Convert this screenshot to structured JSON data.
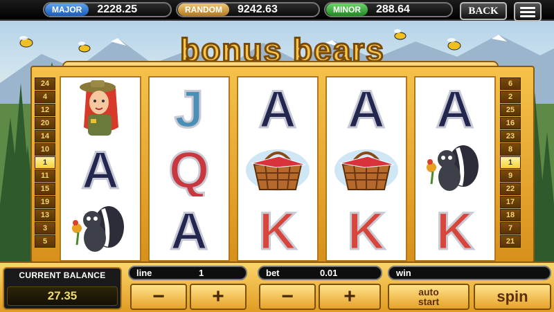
{
  "jackpots": {
    "major": {
      "label": "MAJOR",
      "value": "2228.25"
    },
    "random": {
      "label": "RANDOM",
      "value": "9242.63"
    },
    "minor": {
      "label": "MINOR",
      "value": "288.64"
    }
  },
  "nav": {
    "back_label": "BACK",
    "menu_icon": "hamburger-menu-icon"
  },
  "title": "bonus bears",
  "paylines": {
    "left": [
      "24",
      "4",
      "12",
      "20",
      "14",
      "10",
      "1",
      "11",
      "15",
      "19",
      "13",
      "3",
      "5"
    ],
    "right": [
      "6",
      "2",
      "25",
      "16",
      "23",
      "8",
      "1",
      "9",
      "22",
      "17",
      "18",
      "7",
      "21"
    ],
    "active": "1"
  },
  "reels": [
    [
      "ranger-girl",
      "A",
      "skunk"
    ],
    [
      "J",
      "Q",
      "A"
    ],
    [
      "A",
      "picnic-basket",
      "K"
    ],
    [
      "A",
      "picnic-basket",
      "K"
    ],
    [
      "A",
      "skunk",
      "K"
    ]
  ],
  "colors": {
    "frame": "#e8a52a",
    "A": "#23274f",
    "J": "#4c8fb5",
    "Q": "#c8383f",
    "K": "#d8453a"
  },
  "balance": {
    "label": "CURRENT BALANCE",
    "value": "27.35"
  },
  "line": {
    "label": "line",
    "value": "1"
  },
  "bet": {
    "label": "bet",
    "value": "0.01"
  },
  "win": {
    "label": "win",
    "value": ""
  },
  "controls": {
    "minus": "−",
    "plus": "+",
    "auto_line1": "auto",
    "auto_line2": "start",
    "spin": "spin"
  }
}
